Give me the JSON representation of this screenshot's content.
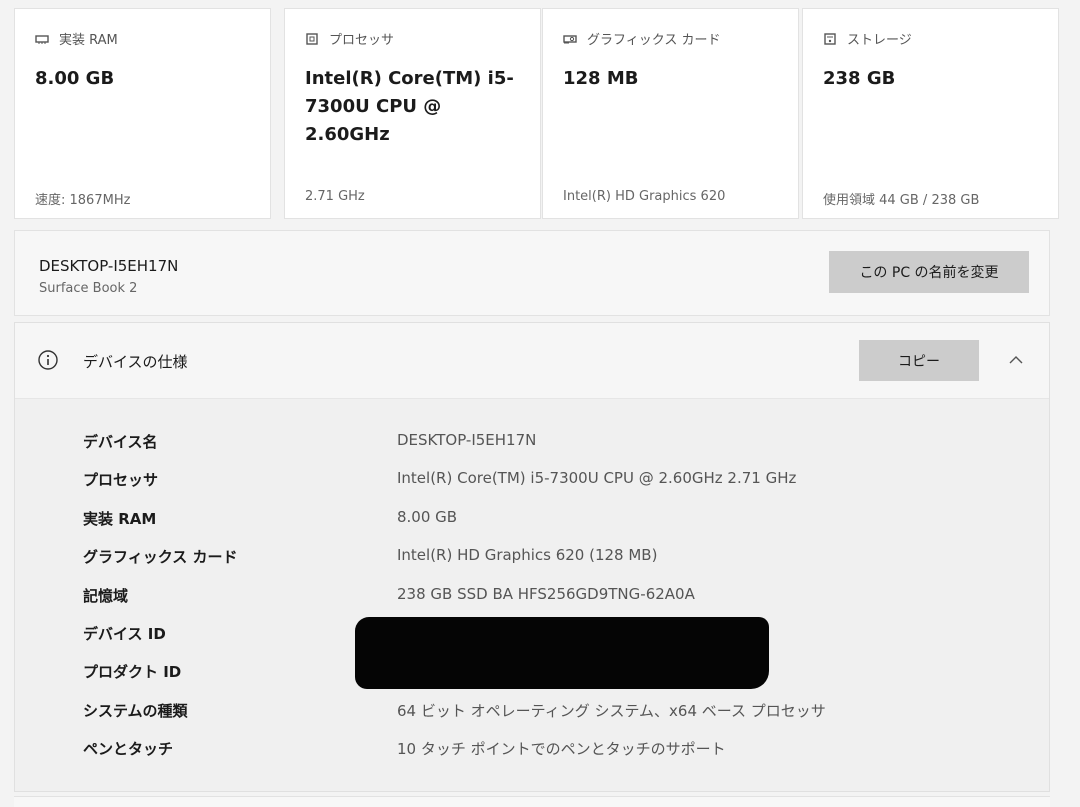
{
  "cards": [
    {
      "icon": "ram-icon",
      "title": "実装 RAM",
      "value": "8.00 GB",
      "footer": "速度: 1867MHz"
    },
    {
      "icon": "processor-icon",
      "title": "プロセッサ",
      "value": "Intel(R) Core(TM) i5-7300U CPU @ 2.60GHz",
      "footer": "2.71 GHz"
    },
    {
      "icon": "graphics-card-icon",
      "title": "グラフィックス カード",
      "value": "128 MB",
      "footer": "Intel(R) HD Graphics 620"
    },
    {
      "icon": "storage-icon",
      "title": "ストレージ",
      "value": "238 GB",
      "footer": "使用領域 44 GB / 238 GB"
    }
  ],
  "device": {
    "name": "DESKTOP-I5EH17N",
    "model": "Surface Book 2",
    "rename_label": "この PC の名前を変更"
  },
  "specs": {
    "title": "デバイスの仕様",
    "copy_label": "コピー",
    "rows": [
      {
        "label": "デバイス名",
        "value": "DESKTOP-I5EH17N"
      },
      {
        "label": "プロセッサ",
        "value": "Intel(R) Core(TM) i5-7300U CPU @ 2.60GHz   2.71 GHz"
      },
      {
        "label": "実装 RAM",
        "value": "8.00 GB"
      },
      {
        "label": "グラフィックス カード",
        "value": "Intel(R) HD Graphics 620 (128 MB)"
      },
      {
        "label": "記憶域",
        "value": "238 GB SSD BA HFS256GD9TNG-62A0A"
      },
      {
        "label": "デバイス ID",
        "value": ""
      },
      {
        "label": "プロダクト ID",
        "value": ""
      },
      {
        "label": "システムの種類",
        "value": "64 ビット オペレーティング システム、x64 ベース プロセッサ"
      },
      {
        "label": "ペンとタッチ",
        "value": "10 タッチ ポイントでのペンとタッチのサポート"
      }
    ]
  }
}
